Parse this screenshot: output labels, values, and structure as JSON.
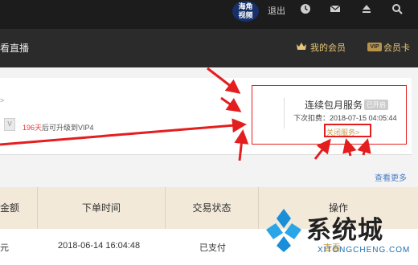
{
  "topbar": {
    "logo_text": "海角\n视频",
    "logout": "退出",
    "icons": [
      "clock-icon",
      "mail-icon",
      "upload-icon",
      "search-icon"
    ]
  },
  "nav": {
    "left_item": "看直播",
    "my_member": "我的会员",
    "vip_badge": "VIP",
    "vip_card": "会员卡"
  },
  "account": {
    "chevron": ">",
    "vip_icon": "V",
    "upgrade_days": "196天",
    "upgrade_text": "后可升级到VIP4"
  },
  "subscription": {
    "title": "连续包月服务",
    "badge": "已开启",
    "deduction": "下次扣费：2018-07-15 04:05:44",
    "close_link": "关闭服务>"
  },
  "orders": {
    "see_more": "查看更多",
    "columns": [
      "金额",
      "下单时间",
      "交易状态",
      "操作"
    ],
    "row": {
      "amount": "元",
      "time": "2018-06-14 16:04:48",
      "status": "已支付",
      "action": "查看"
    }
  },
  "watermark": {
    "text": "系统城",
    "url": "XITONGCHENG.COM"
  },
  "colors": {
    "accent_gold": "#c79f56",
    "annotation_red": "#e41e1e",
    "link_blue": "#4a7cc6"
  }
}
